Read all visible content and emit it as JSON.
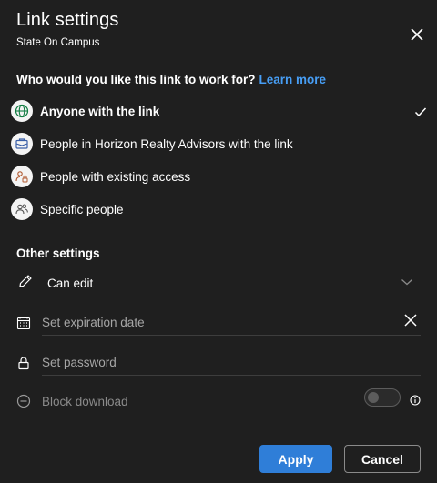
{
  "dialog": {
    "title": "Link settings",
    "subtitle": "State On Campus"
  },
  "audience": {
    "question": "Who would you like this link to work for?",
    "learn_more": "Learn more",
    "options": [
      {
        "label": "Anyone with the link",
        "icon": "globe-icon",
        "selected": true
      },
      {
        "label": "People in Horizon Realty Advisors with the link",
        "icon": "organization-icon",
        "selected": false
      },
      {
        "label": "People with existing access",
        "icon": "people-lock-icon",
        "selected": false
      },
      {
        "label": "Specific people",
        "icon": "people-icon",
        "selected": false
      }
    ]
  },
  "other_settings": {
    "heading": "Other settings",
    "permission": "Can edit",
    "expiration_placeholder": "Set expiration date",
    "password_placeholder": "Set password",
    "block_download": "Block download",
    "block_download_enabled": false
  },
  "buttons": {
    "apply": "Apply",
    "cancel": "Cancel"
  },
  "colors": {
    "background": "#1f1f1f",
    "accent": "#2f7ed8",
    "link": "#479ef5",
    "divider": "#3d3d3d"
  }
}
